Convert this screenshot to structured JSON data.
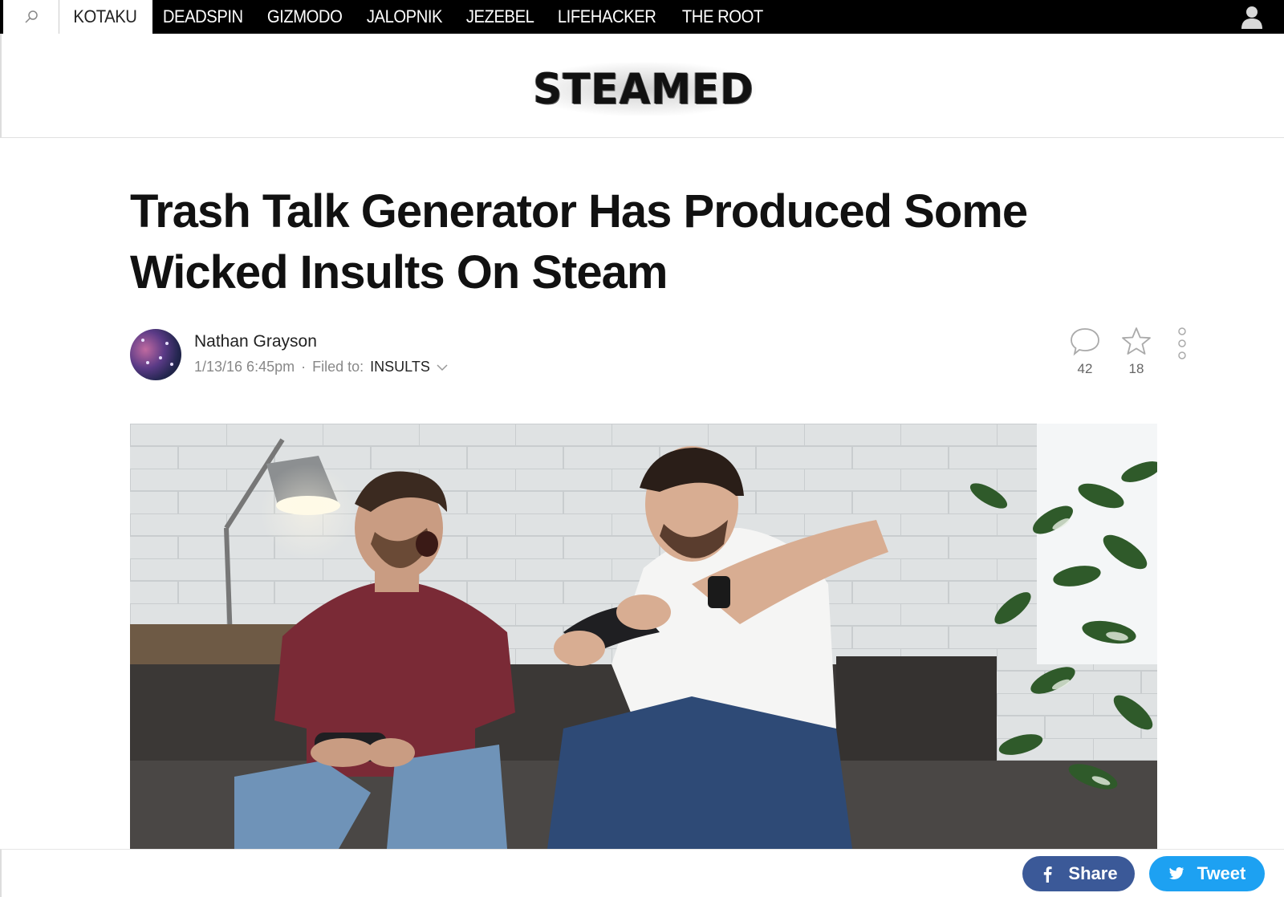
{
  "nav": {
    "items": [
      {
        "label": "KOTAKU",
        "active": true
      },
      {
        "label": "DEADSPIN",
        "active": false
      },
      {
        "label": "GIZMODO",
        "active": false
      },
      {
        "label": "JALOPNIK",
        "active": false
      },
      {
        "label": "JEZEBEL",
        "active": false
      },
      {
        "label": "LIFEHACKER",
        "active": false
      },
      {
        "label": "THE ROOT",
        "active": false
      }
    ],
    "search_icon": "search-icon",
    "user_icon": "user-icon"
  },
  "brand": {
    "logo_text": "STEAMED"
  },
  "article": {
    "title": "Trash Talk Generator Has Produced Some Wicked Insults On Steam",
    "author": "Nathan Grayson",
    "timestamp": "1/13/16 6:45pm",
    "separator": "·",
    "filed_to_label": "Filed to:",
    "filed_to_tag": "INSULTS",
    "comments_count": "42",
    "stars_count": "18"
  },
  "share": {
    "facebook_label": "Share",
    "twitter_label": "Tweet"
  },
  "colors": {
    "nav_bg": "#000000",
    "facebook": "#3b5998",
    "twitter": "#1da1f2"
  }
}
